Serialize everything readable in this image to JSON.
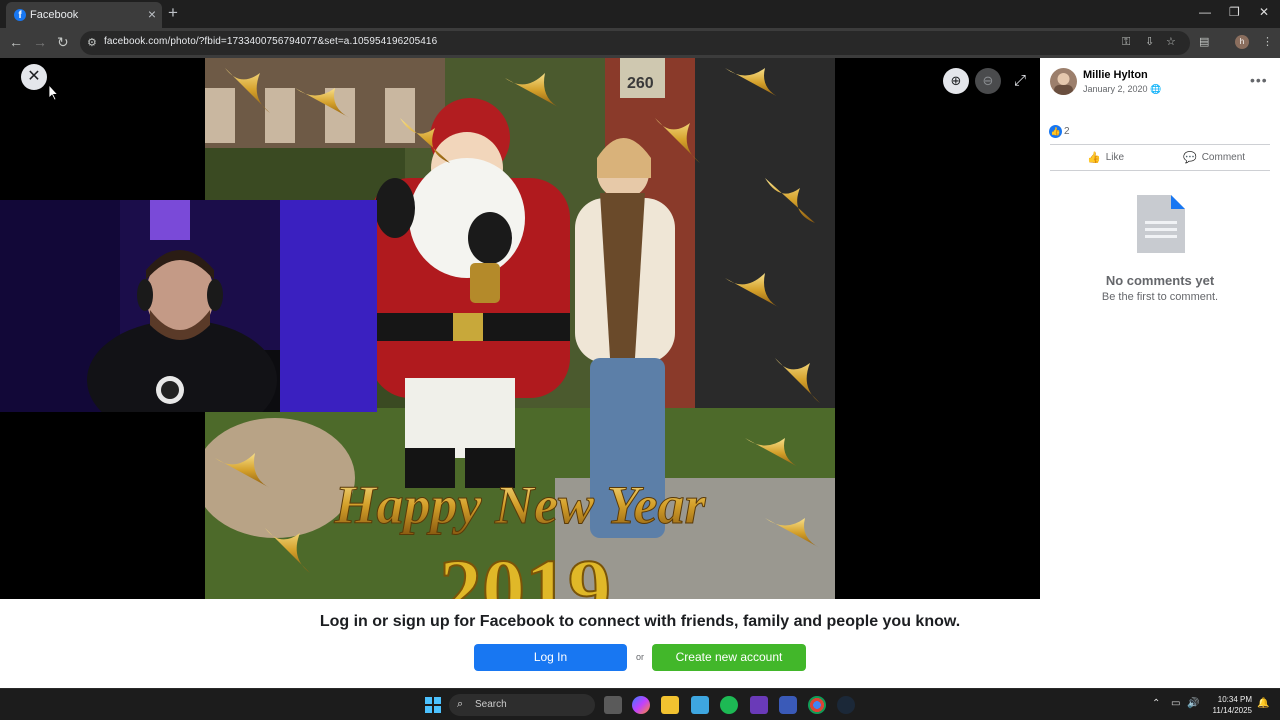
{
  "browser": {
    "tab_title": "Facebook",
    "favicon_letter": "f",
    "url": "facebook.com/photo/?fbid=1733400756794077&set=a.105954196205416",
    "profile_initial": "h"
  },
  "viewer": {
    "photo_caption_line1": "Happy New Year",
    "photo_caption_line2": "2019",
    "house_number": "260"
  },
  "post": {
    "author": "Millie Hylton",
    "date": "January 2, 2020",
    "like_count": "2",
    "like_label": "Like",
    "comment_label": "Comment",
    "no_comments_title": "No comments yet",
    "no_comments_subtitle": "Be the first to comment."
  },
  "login_banner": {
    "title": "Log in or sign up for Facebook to connect with friends, family and people you know.",
    "login_label": "Log In",
    "or_label": "or",
    "create_label": "Create new account"
  },
  "taskbar": {
    "search_label": "Search",
    "time": "10:34 PM",
    "date": "11/14/2025"
  },
  "colors": {
    "facebook_blue": "#1877f2",
    "create_green": "#42b72a",
    "windows_accent": "#4cc2ff"
  }
}
